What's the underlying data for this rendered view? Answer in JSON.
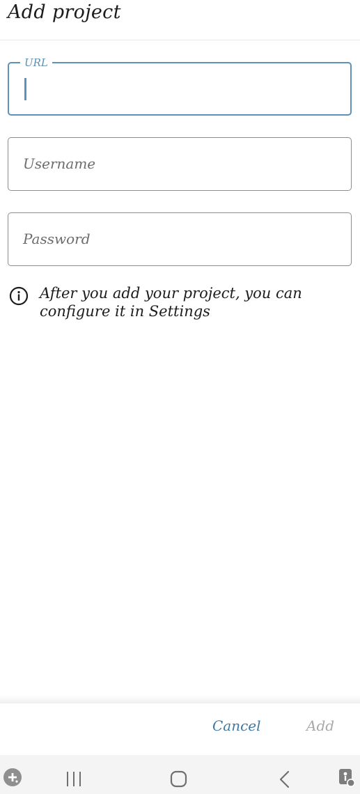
{
  "header": {
    "title": "Add project"
  },
  "form": {
    "url": {
      "label": "URL",
      "value": ""
    },
    "username": {
      "placeholder": "Username",
      "value": ""
    },
    "password": {
      "placeholder": "Password",
      "value": ""
    }
  },
  "info": {
    "icon": "info-circle-icon",
    "text": "After you add your project, you can configure it in Settings"
  },
  "actions": {
    "cancel_label": "Cancel",
    "add_label": "Add",
    "add_enabled": false
  },
  "navbar": {
    "icons": [
      "game-launcher-icon",
      "recent-apps-icon",
      "home-icon",
      "back-icon",
      "accessibility-icon"
    ]
  },
  "colors": {
    "accent": "#5d91b5",
    "link": "#3f78a3",
    "disabled": "#a9a9a9",
    "border": "#8c8c8c"
  }
}
